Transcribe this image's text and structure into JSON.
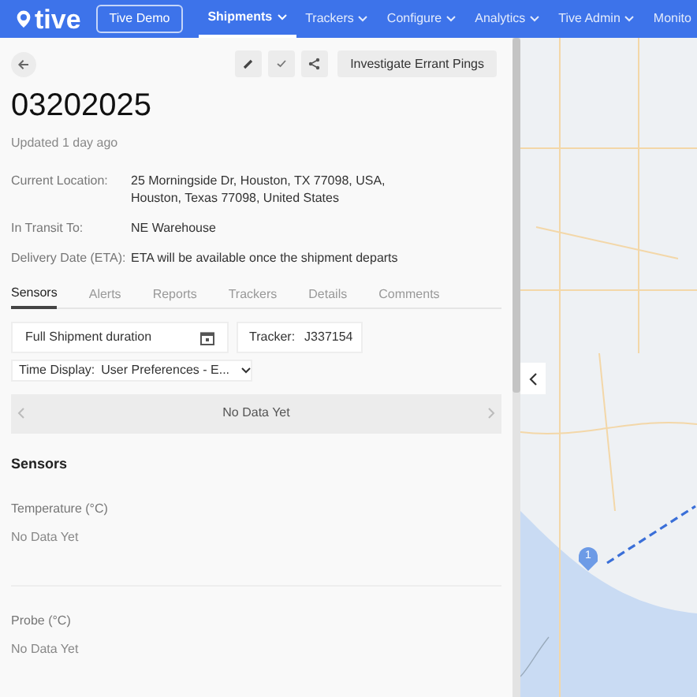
{
  "nav": {
    "logo": "tive",
    "account": "Tive Demo",
    "menus": [
      {
        "label": "Shipments",
        "selected": true
      },
      {
        "label": "Trackers",
        "selected": false
      },
      {
        "label": "Configure",
        "selected": false
      },
      {
        "label": "Analytics",
        "selected": false
      },
      {
        "label": "Tive Admin",
        "selected": false
      },
      {
        "label": "Monito",
        "selected": false
      }
    ]
  },
  "toolbar": {
    "action": "Investigate Errant Pings"
  },
  "shipment": {
    "title": "03202025",
    "updated": "Updated 1 day ago",
    "fields": [
      {
        "label": "Current Location:",
        "value": "25 Morningside Dr, Houston, TX 77098, USA, Houston, Texas 77098, United States"
      },
      {
        "label": "In Transit To:",
        "value": "NE Warehouse"
      },
      {
        "label": "Delivery Date (ETA):",
        "value": "ETA will be available once the shipment departs"
      }
    ]
  },
  "tabs": [
    {
      "label": "Sensors",
      "selected": true
    },
    {
      "label": "Alerts",
      "selected": false
    },
    {
      "label": "Reports",
      "selected": false
    },
    {
      "label": "Trackers",
      "selected": false
    },
    {
      "label": "Details",
      "selected": false
    },
    {
      "label": "Comments",
      "selected": false
    }
  ],
  "filters": {
    "duration": "Full Shipment duration",
    "tracker_label": "Tracker:",
    "tracker": "J337154",
    "time_display_label": "Time Display:",
    "time_display": "User Preferences - E..."
  },
  "timeline": {
    "message": "No Data Yet"
  },
  "sensors": {
    "heading": "Sensors",
    "items": [
      {
        "name": "Temperature (°C)",
        "value": "No Data Yet"
      },
      {
        "name": "Probe (°C)",
        "value": "No Data Yet"
      }
    ]
  },
  "map": {
    "marker": "1"
  }
}
